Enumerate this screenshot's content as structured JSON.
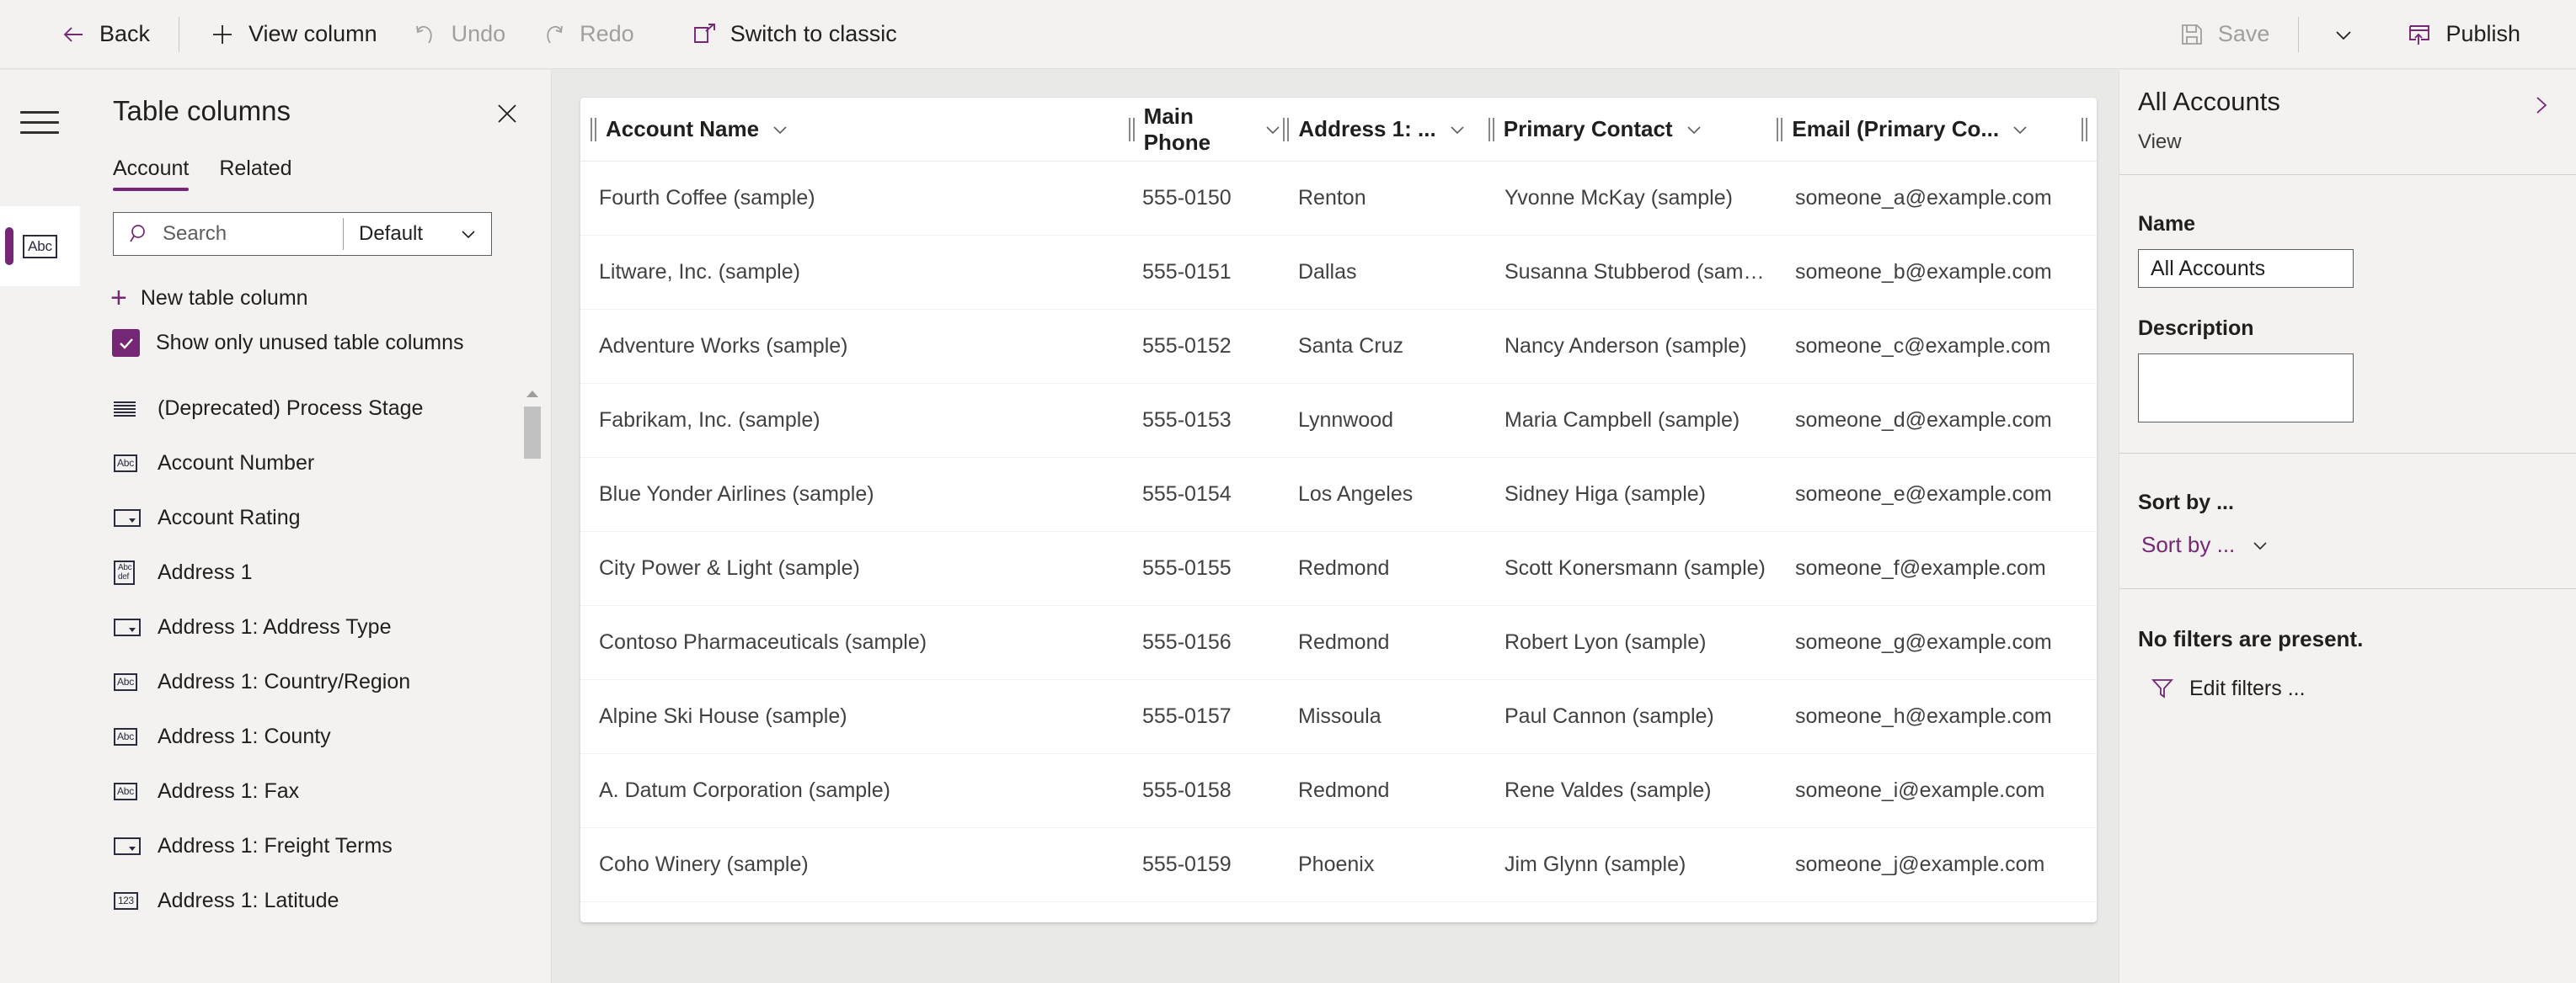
{
  "commandbar": {
    "back_label": "Back",
    "view_column_label": "View column",
    "undo_label": "Undo",
    "redo_label": "Redo",
    "switch_classic_label": "Switch to classic",
    "save_label": "Save",
    "publish_label": "Publish"
  },
  "rail": {
    "hamburger_name": "hamburger-menu-icon",
    "item_icon": "Abc"
  },
  "leftpanel": {
    "title": "Table columns",
    "tabs": [
      {
        "label": "Account",
        "active": true
      },
      {
        "label": "Related",
        "active": false
      }
    ],
    "search": {
      "placeholder": "Search",
      "filter_value": "Default"
    },
    "new_column_label": "New table column",
    "show_unused_label": "Show only unused table columns",
    "show_unused_checked": true,
    "columns": [
      {
        "label": "(Deprecated) Process Stage",
        "icon": "grid-icon"
      },
      {
        "label": "Account Number",
        "icon": "text-icon"
      },
      {
        "label": "Account Rating",
        "icon": "choice-icon"
      },
      {
        "label": "Address 1",
        "icon": "multiline-text-icon"
      },
      {
        "label": "Address 1: Address Type",
        "icon": "choice-icon"
      },
      {
        "label": "Address 1: Country/Region",
        "icon": "text-icon"
      },
      {
        "label": "Address 1: County",
        "icon": "text-icon"
      },
      {
        "label": "Address 1: Fax",
        "icon": "text-icon"
      },
      {
        "label": "Address 1: Freight Terms",
        "icon": "choice-icon"
      },
      {
        "label": "Address 1: Latitude",
        "icon": "number-icon"
      }
    ]
  },
  "grid": {
    "columns": [
      {
        "label": "Account Name"
      },
      {
        "label": "Main Phone"
      },
      {
        "label": "Address 1: ..."
      },
      {
        "label": "Primary Contact"
      },
      {
        "label": "Email (Primary Co..."
      }
    ],
    "rows": [
      {
        "account": "Fourth Coffee (sample)",
        "phone": "555-0150",
        "city": "Renton",
        "contact": "Yvonne McKay (sample)",
        "email": "someone_a@example.com"
      },
      {
        "account": "Litware, Inc. (sample)",
        "phone": "555-0151",
        "city": "Dallas",
        "contact": "Susanna Stubberod (samp...",
        "email": "someone_b@example.com"
      },
      {
        "account": "Adventure Works (sample)",
        "phone": "555-0152",
        "city": "Santa Cruz",
        "contact": "Nancy Anderson (sample)",
        "email": "someone_c@example.com"
      },
      {
        "account": "Fabrikam, Inc. (sample)",
        "phone": "555-0153",
        "city": "Lynnwood",
        "contact": "Maria Campbell (sample)",
        "email": "someone_d@example.com"
      },
      {
        "account": "Blue Yonder Airlines (sample)",
        "phone": "555-0154",
        "city": "Los Angeles",
        "contact": "Sidney Higa (sample)",
        "email": "someone_e@example.com"
      },
      {
        "account": "City Power & Light (sample)",
        "phone": "555-0155",
        "city": "Redmond",
        "contact": "Scott Konersmann (sample)",
        "email": "someone_f@example.com"
      },
      {
        "account": "Contoso Pharmaceuticals (sample)",
        "phone": "555-0156",
        "city": "Redmond",
        "contact": "Robert Lyon (sample)",
        "email": "someone_g@example.com"
      },
      {
        "account": "Alpine Ski House (sample)",
        "phone": "555-0157",
        "city": "Missoula",
        "contact": "Paul Cannon (sample)",
        "email": "someone_h@example.com"
      },
      {
        "account": "A. Datum Corporation (sample)",
        "phone": "555-0158",
        "city": "Redmond",
        "contact": "Rene Valdes (sample)",
        "email": "someone_i@example.com"
      },
      {
        "account": "Coho Winery (sample)",
        "phone": "555-0159",
        "city": "Phoenix",
        "contact": "Jim Glynn (sample)",
        "email": "someone_j@example.com"
      }
    ]
  },
  "rightpanel": {
    "title": "All Accounts",
    "subtitle": "View",
    "name_label": "Name",
    "name_value": "All Accounts",
    "description_label": "Description",
    "description_value": "",
    "sort_label": "Sort by ...",
    "sort_value": "Sort by ...",
    "no_filters_label": "No filters are present.",
    "edit_filters_label": "Edit filters ..."
  },
  "colors": {
    "accent": "#742774",
    "chrome": "#f3f2f1",
    "canvas": "#e9e9e7",
    "text": "#201f1e",
    "disabled": "#a19f9d"
  }
}
